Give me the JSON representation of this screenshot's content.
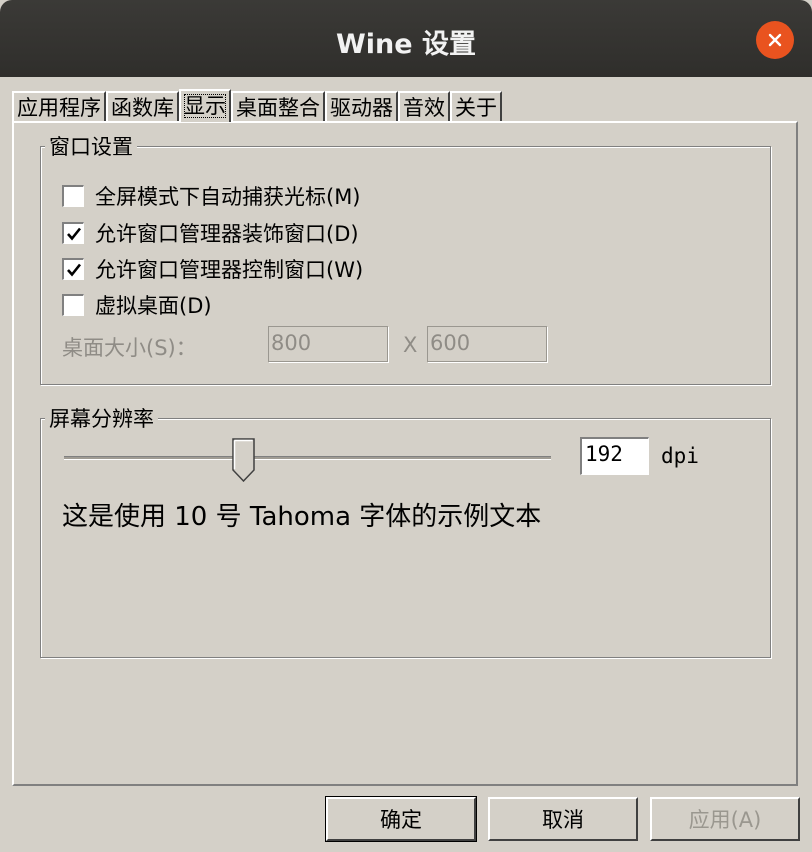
{
  "window": {
    "title": "Wine 设置"
  },
  "tabs": [
    {
      "label": "应用程序"
    },
    {
      "label": "函数库"
    },
    {
      "label": "显示"
    },
    {
      "label": "桌面整合"
    },
    {
      "label": "驱动器"
    },
    {
      "label": "音效"
    },
    {
      "label": "关于"
    }
  ],
  "active_tab": "显示",
  "window_settings": {
    "group_label": "窗口设置",
    "options": [
      {
        "label": "全屏模式下自动捕获光标(M)",
        "checked": false
      },
      {
        "label": "允许窗口管理器装饰窗口(D)",
        "checked": true
      },
      {
        "label": "允许窗口管理器控制窗口(W)",
        "checked": true
      },
      {
        "label": "虚拟桌面(D)",
        "checked": false
      }
    ],
    "desktop_size_label": "桌面大小(S)：",
    "width": "800",
    "separator": "X",
    "height": "600"
  },
  "resolution": {
    "group_label": "屏幕分辨率",
    "dpi_value": "192",
    "dpi_unit": "dpi",
    "sample_text": "这是使用 10 号 Tahoma 字体的示例文本"
  },
  "buttons": {
    "ok": "确定",
    "cancel": "取消",
    "apply": "应用(A)"
  }
}
